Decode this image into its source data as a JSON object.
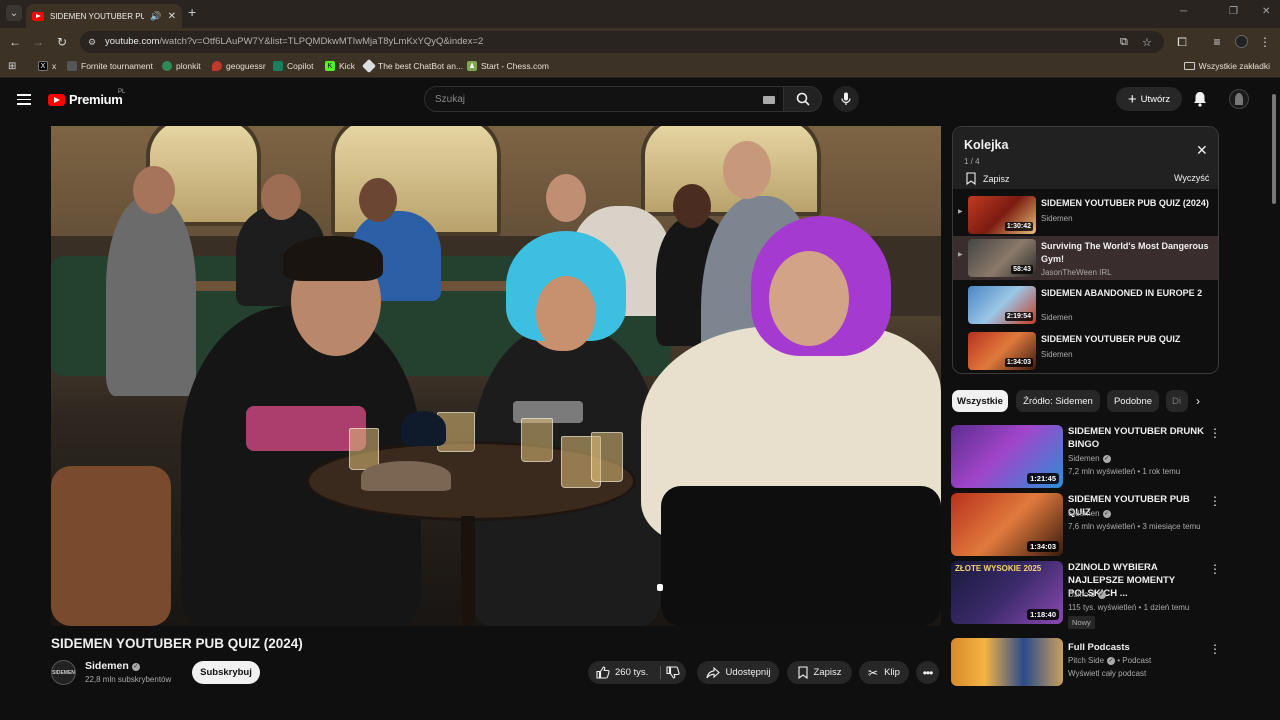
{
  "browser": {
    "tab_title": "SIDEMEN YOUTUBER PUB Q",
    "url_host": "youtube.com",
    "url_path": "/watch?v=Otf6LAuPW7Y&list=TLPQMDkwMTIwMjaT8yLmKxYQyQ&index=2",
    "bookmarks": [
      {
        "label": "x",
        "icon": "x-logo-icon",
        "color": "#000000"
      },
      {
        "label": "Fornite tournament",
        "icon": "fortnite-icon",
        "color": "#555555"
      },
      {
        "label": "plonkit",
        "icon": "plonkit-icon",
        "color": "#2e8b57"
      },
      {
        "label": "geoguessr",
        "icon": "geoguessr-icon",
        "color": "#c0392b"
      },
      {
        "label": "Copilot",
        "icon": "copilot-icon",
        "color": "#1a7f5a"
      },
      {
        "label": "Kick",
        "icon": "kick-icon",
        "color": "#53fc18"
      },
      {
        "label": "The best ChatBot an...",
        "icon": "chatbot-icon",
        "color": "#dddddd"
      },
      {
        "label": "Start - Chess.com",
        "icon": "chess-icon",
        "color": "#7fa650"
      }
    ],
    "bookmarks_folder": "Wszystkie zakładki"
  },
  "masthead": {
    "logo_text": "Premium",
    "region": "PL",
    "search_placeholder": "Szukaj",
    "create_label": "Utwórz"
  },
  "video": {
    "title": "SIDEMEN YOUTUBER PUB QUIZ (2024)",
    "channel": "Sidemen",
    "channel_avatar_text": "SIDEMEN",
    "subscribers": "22,8 mln subskrybentów",
    "subscribe_label": "Subskrybuj",
    "likes": "260 tys.",
    "share_label": "Udostępnij",
    "save_label": "Zapisz",
    "clip_label": "Klip"
  },
  "queue": {
    "title": "Kolejka",
    "count": "1 / 4",
    "save_label": "Zapisz",
    "clear_label": "Wyczyść",
    "items": [
      {
        "title": "SIDEMEN YOUTUBER PUB QUIZ (2024)",
        "channel": "Sidemen",
        "duration": "1:30:42"
      },
      {
        "title": "Surviving The World's Most Dangerous Gym!",
        "channel": "JasonTheWeen IRL",
        "duration": "58:43"
      },
      {
        "title": "SIDEMEN ABANDONED IN EUROPE 2",
        "channel": "Sidemen",
        "duration": "2:19:54"
      },
      {
        "title": "SIDEMEN YOUTUBER PUB QUIZ",
        "channel": "Sidemen",
        "duration": "1:34:03"
      }
    ]
  },
  "chips": [
    "Wszystkie",
    "Źródło: Sidemen",
    "Podobne",
    "Di"
  ],
  "recommendations": [
    {
      "title": "SIDEMEN YOUTUBER DRUNK BINGO",
      "channel": "Sidemen",
      "meta": "7,2 mln wyświetleń • 1 rok temu",
      "duration": "1:21:45"
    },
    {
      "title": "SIDEMEN YOUTUBER PUB QUIZ",
      "channel": "Sidemen",
      "meta": "7,6 mln wyświetleń • 3 miesiące temu",
      "duration": "1:34:03"
    },
    {
      "title": "DZINOLD WYBIERA NAJLEPSZE MOMENTY POLSKICH ...",
      "channel": "Dzinold",
      "meta": "115 tys. wyświetleń • 1 dzień temu",
      "duration": "1:18:40",
      "badge": "Nowy",
      "thumb_text": "ZŁOTE WYSOKIE 2025"
    },
    {
      "title": "Full Podcasts",
      "channel": "Pitch Side",
      "channel_suffix": "• Podcast",
      "meta": "Wyświetl cały podcast"
    }
  ]
}
